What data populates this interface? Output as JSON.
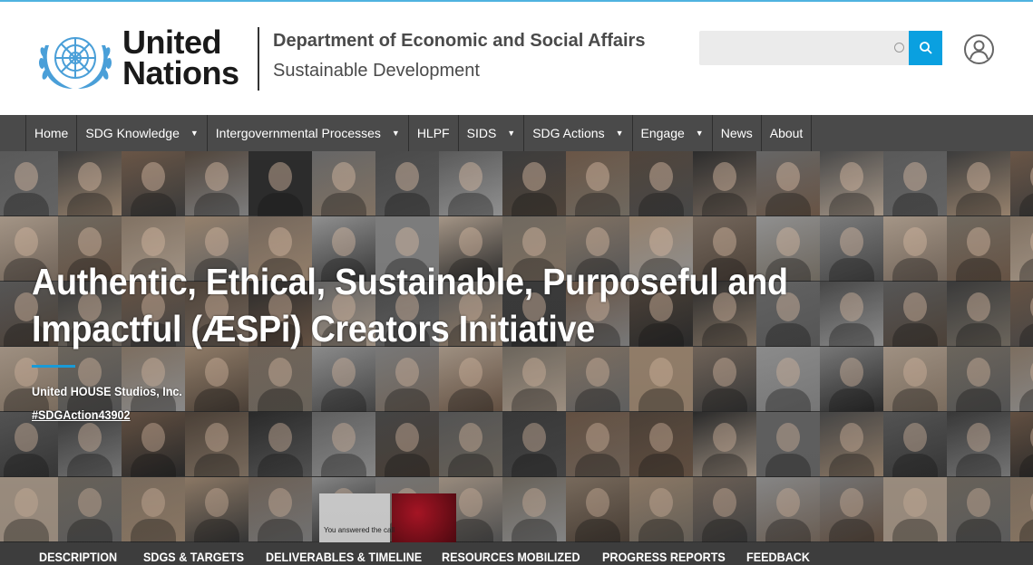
{
  "header": {
    "logo_text_line1": "United",
    "logo_text_line2": "Nations",
    "department": "Department of Economic and Social Affairs",
    "division": "Sustainable Development"
  },
  "search": {
    "placeholder": "",
    "value": ""
  },
  "nav": {
    "items": [
      {
        "label": "Home",
        "dropdown": false
      },
      {
        "label": "SDG Knowledge",
        "dropdown": true
      },
      {
        "label": "Intergovernmental Processes",
        "dropdown": true
      },
      {
        "label": "HLPF",
        "dropdown": false
      },
      {
        "label": "SIDS",
        "dropdown": true
      },
      {
        "label": "SDG Actions",
        "dropdown": true
      },
      {
        "label": "Engage",
        "dropdown": true
      },
      {
        "label": "News",
        "dropdown": false
      },
      {
        "label": "About",
        "dropdown": false
      }
    ]
  },
  "hero": {
    "title": "Authentic, Ethical, Sustainable, Purposeful and Impactful (ÆSPi) Creators Initiative",
    "organization": "United HOUSE Studios, Inc.",
    "action_tag": "#SDGAction43902",
    "tile_caption": "You answered the call"
  },
  "tabs": [
    "DESCRIPTION",
    "SDGS & TARGETS",
    "DELIVERABLES & TIMELINE",
    "RESOURCES MOBILIZED",
    "PROGRESS REPORTS",
    "FEEDBACK"
  ],
  "colors": {
    "accent": "#0aa0e0",
    "nav_bg": "#4a4a4a",
    "tabs_bg": "#3d3d3d",
    "text_dark": "#4a4a4a"
  },
  "icons": {
    "logo": "un-emblem-icon",
    "search": "search-icon",
    "user": "user-account-icon",
    "dropdown": "caret-down-icon"
  }
}
